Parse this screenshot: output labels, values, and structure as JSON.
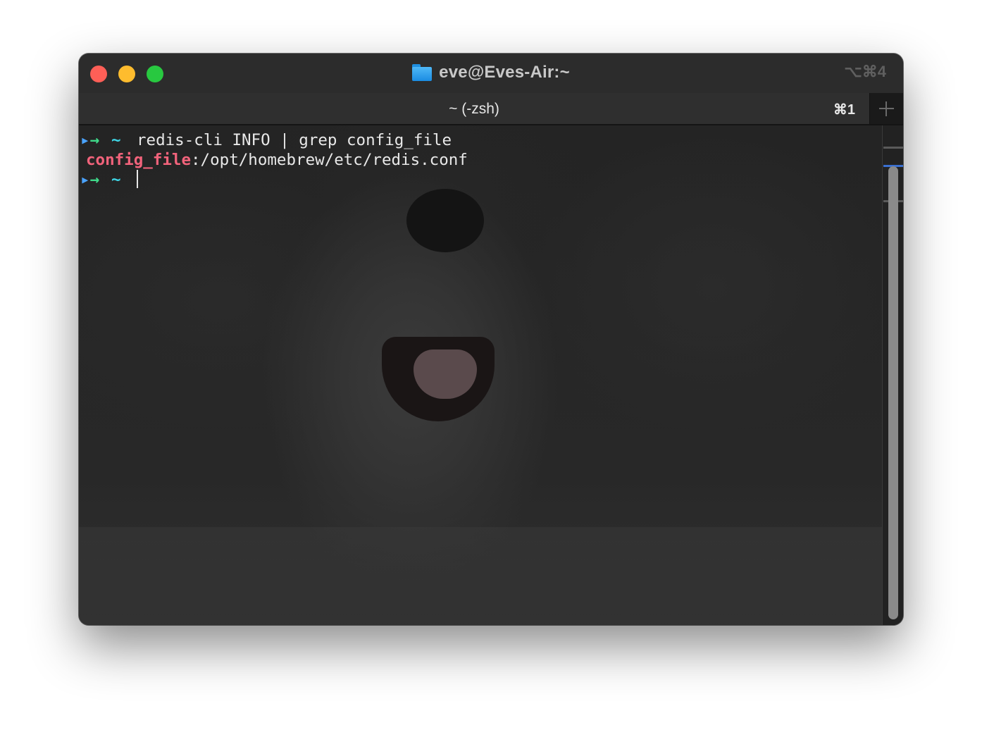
{
  "window": {
    "title": "eve@Eves-Air:~",
    "window_shortcut": "⌥⌘4"
  },
  "tab": {
    "label": "~ (-zsh)",
    "shortcut": "⌘1"
  },
  "terminal": {
    "lines": [
      {
        "prompt_arrow": "→",
        "prompt_dir": "~",
        "command": "redis-cli INFO | grep config_file"
      },
      {
        "key": "config_file",
        "value": ":/opt/homebrew/etc/redis.conf"
      },
      {
        "prompt_arrow": "→",
        "prompt_dir": "~"
      }
    ]
  },
  "colors": {
    "close": "#fe5f57",
    "minimize": "#febc2e",
    "zoom": "#28c840",
    "prompt_arrow": "#3fd98a",
    "prompt_dir": "#3fd6e6",
    "highlight_key": "#f2637b",
    "scroll_marker": "#3a6fd0"
  },
  "icons": {
    "title": "folder-icon",
    "new_tab": "plus-icon"
  }
}
